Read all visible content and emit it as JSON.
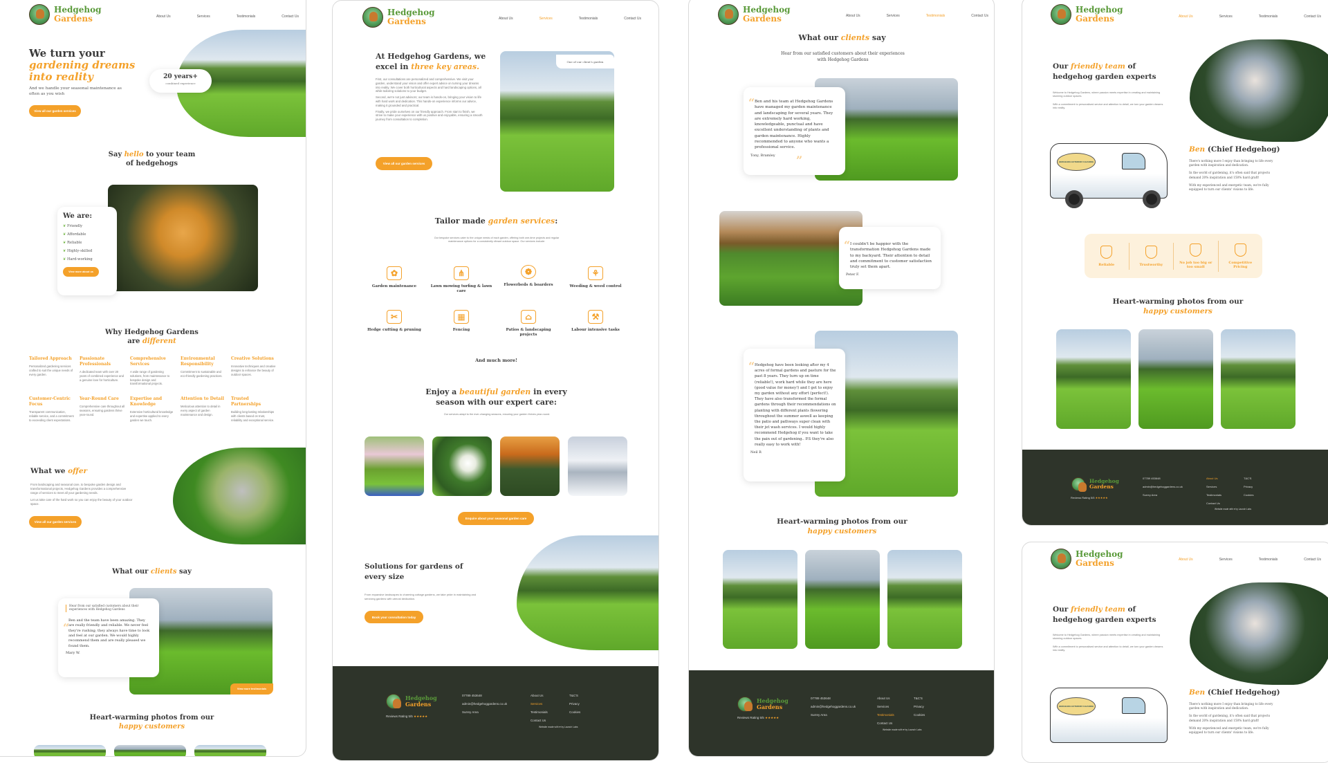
{
  "brand": {
    "name_line1": "Hedgehog",
    "name_line2": "Gardens"
  },
  "nav": [
    "About Us",
    "Services",
    "Testimonials",
    "Contact Us"
  ],
  "colors": {
    "accent": "#f4a12a",
    "brand_green": "#5a9a3a",
    "footer_bg": "#2e342a",
    "text": "#3a3a3a"
  },
  "home": {
    "hero": {
      "title_line1": "We turn your",
      "title_accent1": "gardening dreams",
      "title_accent2": "into reality",
      "subtitle": "And we handle your seasonal maintenance as often as you wish",
      "cta": "View all our garden services",
      "stat_value": "20 years+",
      "stat_label": "combined experience"
    },
    "team": {
      "title_pre": "Say",
      "title_accent": "hello",
      "title_post": "to your team",
      "title_line2": "of hedgehogs",
      "card_title": "We are:",
      "traits": [
        "Friendly",
        "Affordable",
        "Reliable",
        "Highly-skilled",
        "Hard-working"
      ],
      "cta": "View more about us"
    },
    "why": {
      "title_line1": "Why Hedgehog Gardens",
      "title_pre2": "are",
      "title_accent": "different",
      "items": [
        {
          "title": "Tailored Approach",
          "desc": "Personalized gardening services crafted to suit the unique needs of every garden."
        },
        {
          "title": "Passionate Professionals",
          "desc": "A dedicated team with over 20 years of combined experience and a genuine love for horticulture."
        },
        {
          "title": "Comprehensive Services",
          "desc": "A wide range of gardening solutions, from maintenance to bespoke design and transformational projects."
        },
        {
          "title": "Environmental Responsibility",
          "desc": "Commitment to sustainable and eco-friendly gardening practices."
        },
        {
          "title": "Creative Solutions",
          "desc": "Innovative techniques and creative designs to enhance the beauty of outdoor spaces."
        },
        {
          "title": "Customer-Centric Focus",
          "desc": "Transparent communication, reliable service, and a commitment to exceeding client expectations."
        },
        {
          "title": "Year-Round Care",
          "desc": "Comprehensive care throughout all seasons, ensuring gardens thrive year-round."
        },
        {
          "title": "Expertise and Knowledge",
          "desc": "Extensive horticultural knowledge and expertise applied to every garden we touch."
        },
        {
          "title": "Attention to Detail",
          "desc": "Meticulous attention to detail in every aspect of garden maintenance and design."
        },
        {
          "title": "Trusted Partnerships",
          "desc": "Building long-lasting relationships with clients based on trust, reliability and exceptional service."
        }
      ]
    },
    "offer": {
      "title_pre": "What we",
      "title_accent": "offer",
      "p1": "From landscaping and seasonal care, to bespoke garden design and transformational projects, Hedgehog Gardens provides a comprehensive range of services to meet all your gardening needs.",
      "p2": "Let us take care of the hard work so you can enjoy the beauty of your outdoor space.",
      "cta": "View all our garden services"
    },
    "clients": {
      "title_pre": "What our",
      "title_accent": "clients",
      "title_post": "say",
      "intro": "Hear from our satisfied customers about their experiences with Hedgehog Gardens",
      "quote": "Ben and the team have been amazing. They are really friendly and reliable. We never feel they're rushing; they always have time to look and feel at our garden. We would highly recommend them and are really pleased we found them.",
      "author": "Mary W.",
      "cta": "View more testimonials"
    },
    "photos": {
      "title_line1": "Heart-warming photos from our",
      "title_accent": "happy customers"
    }
  },
  "services": {
    "intro": {
      "title_line1": "At Hedgehog Gardens, we",
      "title_pre2": "excel in",
      "title_accent": "three key areas.",
      "p1": "First, our consultations are personalized and comprehensive. We visit your garden, understand your vision and offer expert advice on turning your dreams into reality. We cover both horticultural aspects and hard landscaping options, all while tailoring solutions to your budget.",
      "p2": "Second, we're not just advisors; our team is hands-on, bringing your vision to life with hard work and dedication. This hands-on experience informs our advice, making it grounded and practical.",
      "p3": "Finally, we pride ourselves on our friendly approach. From start to finish, we strive to make your experience with us positive and enjoyable, ensuring a smooth journey from consultation to completion.",
      "cta": "View all our garden services",
      "image_caption": "One of our client's garden"
    },
    "tailor": {
      "title_pre": "Tailor made",
      "title_accent": "garden services",
      "title_post": ":",
      "desc": "Our bespoke services cater to the unique needs of each garden, offering both one-time projects and regular maintenance options for a consistently vibrant outdoor space. Our services include:",
      "items": [
        {
          "label": "Garden maintenance",
          "icon": "flowers-icon"
        },
        {
          "label": "Lawn mowing turfing & lawn care",
          "icon": "grass-icon"
        },
        {
          "label": "Flowerbeds & boarders",
          "icon": "rose-icon"
        },
        {
          "label": "Weeding & weed control",
          "icon": "weeding-icon"
        },
        {
          "label": "Hedge cutting & pruning",
          "icon": "hedge-trimmer-icon"
        },
        {
          "label": "Fencing",
          "icon": "fence-icon"
        },
        {
          "label": "Patios & landscaping projects",
          "icon": "landscape-plan-icon"
        },
        {
          "label": "Labour intensive tasks",
          "icon": "tools-icon"
        }
      ],
      "more": "And much more!"
    },
    "seasons": {
      "title_pre": "Enjoy a",
      "title_accent": "beautiful garden",
      "title_post": "in every",
      "title_line2": "season with our expert care:",
      "desc": "Our services adapt to the ever-changing seasons, ensuring your garden thrives year-round.",
      "cta": "Enquire about your seasonal garden care"
    },
    "solutions": {
      "title": "Solutions for gardens of every size",
      "desc": "From expansive landscapes to charming cottage gardens, we take pride in maintaining and servicing gardens with utmost dedication.",
      "cta": "Book your consultation today"
    }
  },
  "testimonials": {
    "title_pre": "What our",
    "title_accent": "clients",
    "title_post": "say",
    "intro": "Hear from our satisfied customers about their experiences with Hedgehog Gardens",
    "items": [
      {
        "quote": "Ben and his team at Hedgehog Gardens have managed my garden maintenance and landscaping for several years. They are extremely hard working, knowledgeable, punctual and have excellent understanding of plants and garden maintenance. Highly recommended to anyone who wants a professional service.",
        "author": "Tony, Bramley"
      },
      {
        "quote": "I couldn't be happier with the transformation Hedgehog Gardens made to my backyard. Their attention to detail and commitment to customer satisfaction truly set them apart.",
        "author": "Peter F."
      },
      {
        "quote": "Hedgehog have been looking after my 4 acres of formal gardens and pasture for the past 8 years. They turn up on time (reliable!), work hard while they are here (good value for money!) and I get to enjoy my garden without any effort (perfect!). They have also transformed the formal gardens through their recommendations on planting with different plants flowering throughout the summer aswell as keeping the patio and pathways super clean with their jet wash services. I would highly recommend Hedgehog if you want to take the pain out of gardening.. P.S they're also really easy to work with!",
        "author": "Neil R"
      }
    ],
    "photos_title_line1": "Heart-warming photos from our",
    "photos_title_accent": "happy customers"
  },
  "about": {
    "title_pre": "Our",
    "title_accent": "friendly team",
    "title_post": "of",
    "title_line2": "hedgehog garden experts",
    "p1": "Welcome to Hedgehog Gardens, where passion meets expertise in creating and maintaining stunning outdoor spaces.",
    "p2": "With a commitment to personalised service and attention to detail, we turn your garden dreams into reality.",
    "ben_name": "Ben",
    "ben_role": "(Chief Hedgehog)",
    "ben_p1": "There's nothing more I enjoy than bringing to life every garden with inspiration and dedication.",
    "ben_p2": "In the world of gardening, it's often said that projects demand 20% inspiration and 150% hard graft!",
    "ben_p3": "With my experienced and energetic team, we're fully equipped to turn our clients' visions to life.",
    "van_sign": "HEDGEHOG EXTERIOR CLEANING",
    "values": [
      "Reliable",
      "Trustworthy",
      "No job too big or too small",
      "Competitive Pricing"
    ],
    "photos_title_line1": "Heart-warming photos from our",
    "photos_title_accent": "happy customers"
  },
  "footer": {
    "rating": "Reviews Rating 5/5",
    "stars": "★★★★★",
    "phone": "07789 453648",
    "email": "admin@hedgehoggardens.co.uk",
    "area": "Surrey Area",
    "links": [
      "About Us",
      "Services",
      "Testimonials",
      "Contact Us"
    ],
    "legal": [
      "T&C'S",
      "Privacy",
      "Cookies"
    ],
    "credit": "Website made with ♥ by Launch Labs"
  }
}
